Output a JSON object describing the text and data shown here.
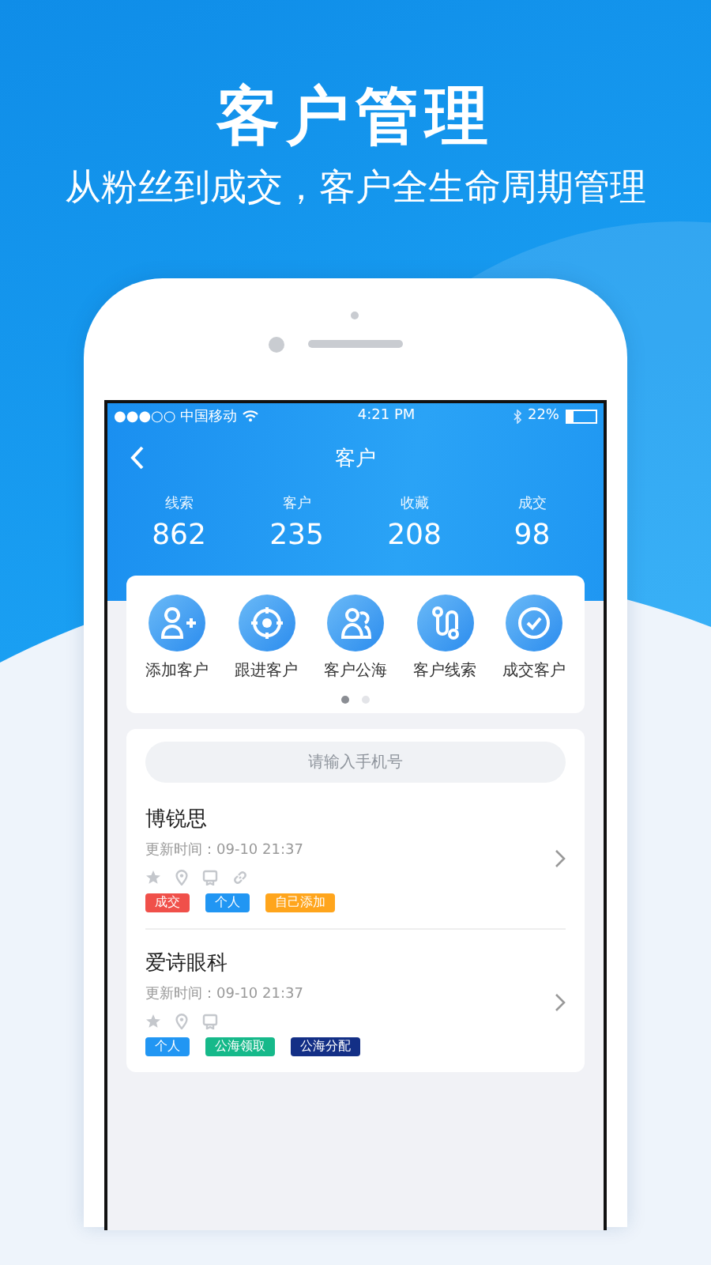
{
  "promo": {
    "title": "客户管理",
    "subtitle": "从粉丝到成交，客户全生命周期管理"
  },
  "status_bar": {
    "carrier": "●●●○○ 中国移动",
    "time": "4:21 PM",
    "battery": "22%"
  },
  "nav": {
    "title": "客户"
  },
  "stats": [
    {
      "label": "线索",
      "value": "862"
    },
    {
      "label": "客户",
      "value": "235"
    },
    {
      "label": "收藏",
      "value": "208"
    },
    {
      "label": "成交",
      "value": "98"
    }
  ],
  "quick_actions": [
    {
      "label": "添加客户"
    },
    {
      "label": "跟进客户"
    },
    {
      "label": "客户公海"
    },
    {
      "label": "客户线索"
    },
    {
      "label": "成交客户"
    }
  ],
  "pager": [
    {
      "selected": true
    },
    {
      "selected": false
    }
  ],
  "search": {
    "placeholder": "请输入手机号"
  },
  "customers": [
    {
      "name": "博锐思",
      "updated": "更新时间：09-10 21:37",
      "linked": true,
      "tags": [
        {
          "text": "成交",
          "color": "#f0504a"
        },
        {
          "text": "个人",
          "color": "#2196f3"
        },
        {
          "text": "自己添加",
          "color": "#ffa51c"
        }
      ]
    },
    {
      "name": "爱诗眼科",
      "updated": "更新时间：09-10 21:37",
      "linked": false,
      "tags": [
        {
          "text": "个人",
          "color": "#2196f3"
        },
        {
          "text": "公海领取",
          "color": "#16b98a"
        },
        {
          "text": "公海分配",
          "color": "#132f86"
        }
      ]
    }
  ]
}
